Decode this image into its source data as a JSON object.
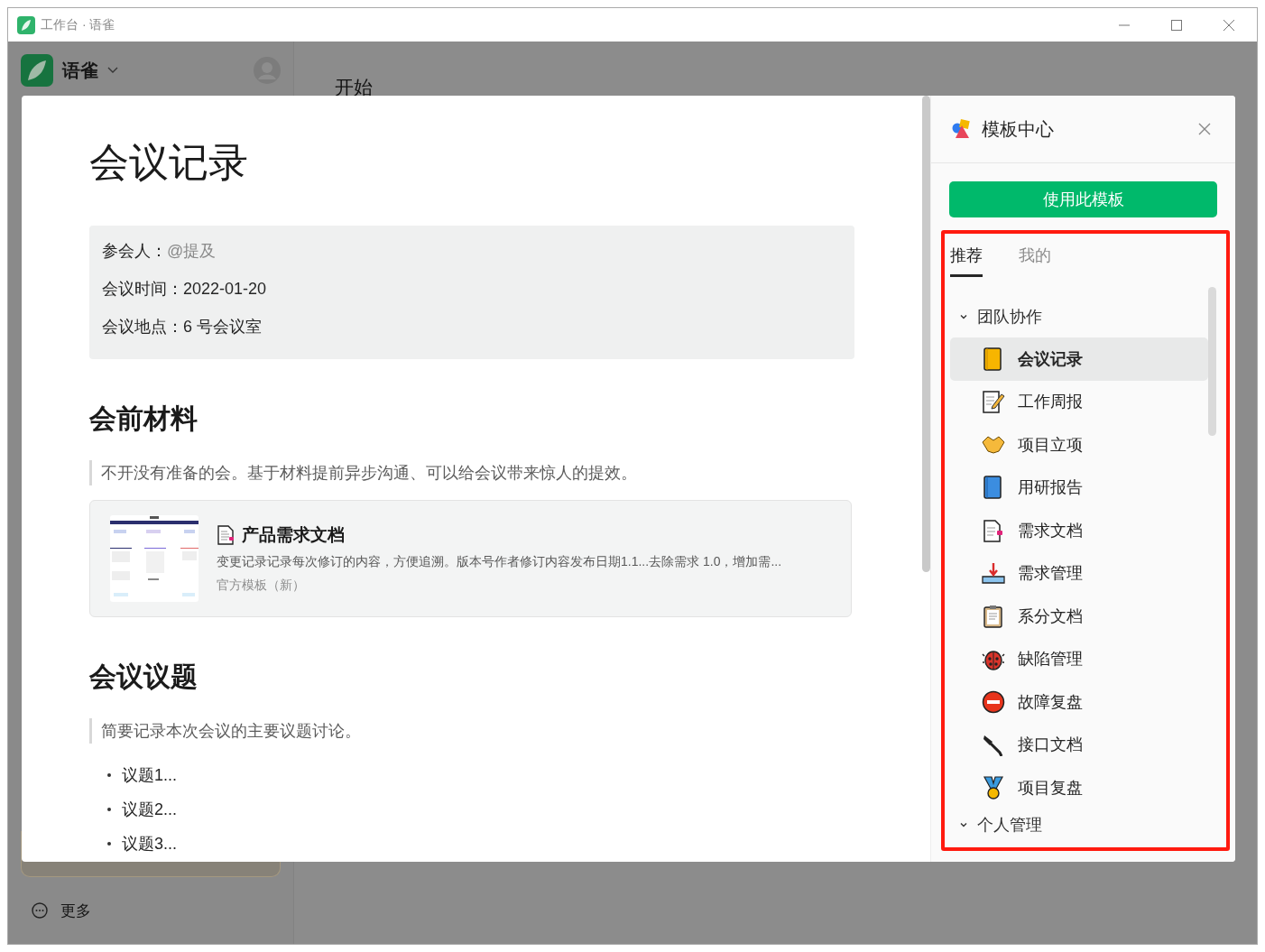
{
  "window": {
    "title": "工作台 · 语雀"
  },
  "app": {
    "brand": "语雀",
    "page_heading": "开始",
    "more": "更多"
  },
  "document": {
    "title": "会议记录",
    "info": [
      {
        "label": "参会人：",
        "value": "@提及",
        "muted": true
      },
      {
        "label": "会议时间：",
        "value": "2022-01-20",
        "muted": false
      },
      {
        "label": "会议地点：",
        "value": "6 号会议室",
        "muted": false
      }
    ],
    "sections": [
      {
        "heading": "会前材料",
        "quote": "不开没有准备的会。基于材料提前异步沟通、可以给会议带来惊人的提效。",
        "card": {
          "title": "产品需求文档",
          "description": "变更记录记录每次修订的内容，方便追溯。版本号作者修订内容发布日期1.1...去除需求 1.0，增加需...",
          "meta": "官方模板（新）"
        }
      },
      {
        "heading": "会议议题",
        "quote": "简要记录本次会议的主要议题讨论。",
        "bullets": [
          "议题1...",
          "议题2...",
          "议题3..."
        ]
      }
    ]
  },
  "template_panel": {
    "title": "模板中心",
    "use_button": "使用此模板",
    "tabs": [
      {
        "label": "推荐",
        "selected": true
      },
      {
        "label": "我的",
        "selected": false
      }
    ],
    "groups": [
      {
        "name": "团队协作",
        "expanded": true,
        "items": [
          {
            "label": "会议记录",
            "selected": true
          },
          {
            "label": "工作周报",
            "selected": false
          },
          {
            "label": "项目立项",
            "selected": false
          },
          {
            "label": "用研报告",
            "selected": false
          },
          {
            "label": "需求文档",
            "selected": false
          },
          {
            "label": "需求管理",
            "selected": false
          },
          {
            "label": "系分文档",
            "selected": false
          },
          {
            "label": "缺陷管理",
            "selected": false
          },
          {
            "label": "故障复盘",
            "selected": false
          },
          {
            "label": "接口文档",
            "selected": false
          },
          {
            "label": "项目复盘",
            "selected": false
          }
        ]
      },
      {
        "name": "个人管理",
        "expanded": true
      }
    ]
  }
}
